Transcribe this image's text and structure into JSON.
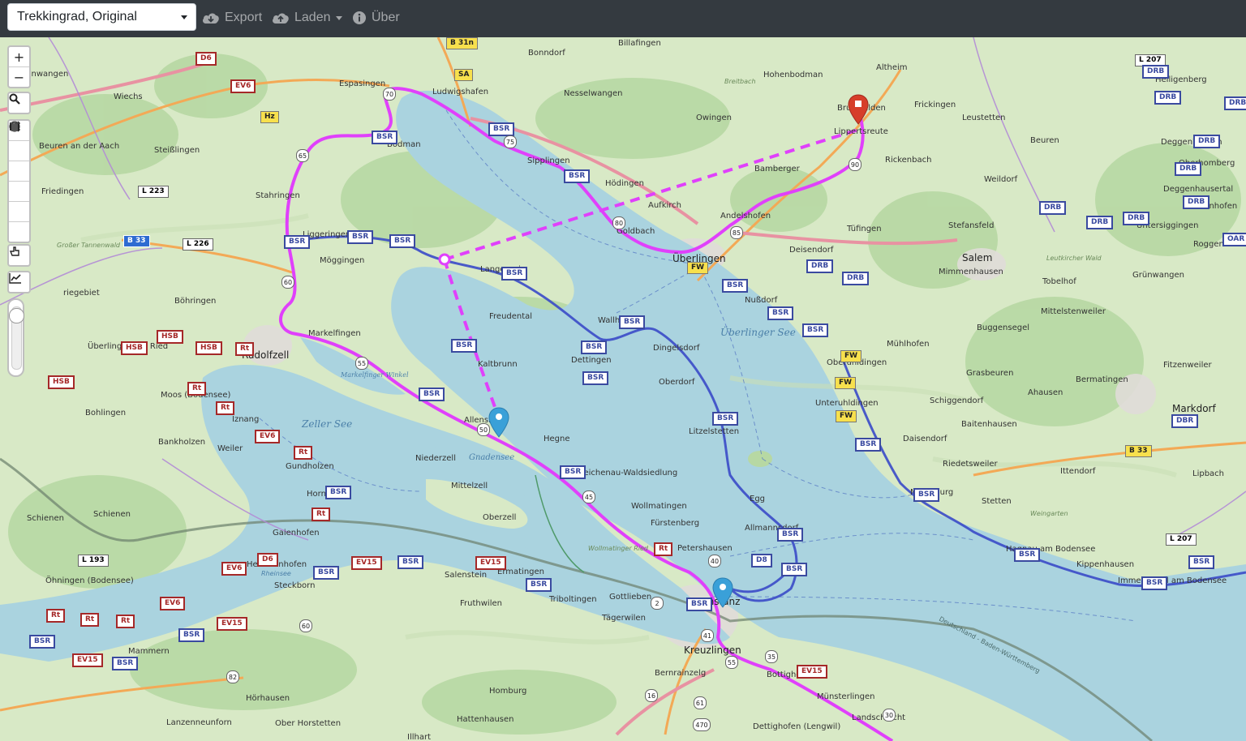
{
  "toolbar": {
    "profile_selected": "Trekkingrad, Original",
    "export_label": "Export",
    "load_label": "Laden",
    "about_label": "Über"
  },
  "map_controls": {
    "zoom_in": "+",
    "zoom_out": "−",
    "search_icon": "search-icon",
    "draw_icon": "pencil-icon",
    "reroute_icon": "shuffle-icon",
    "nogo_icon": "forbidden-icon",
    "circle_icon": "circle-icon",
    "beeline_icon": "beeline-icon",
    "delete_icon": "trash-icon",
    "undo_icon": "hand-pointer-icon",
    "elevation_icon": "chart-line-icon"
  },
  "colors": {
    "route_magenta": "#e040fb",
    "route_blue": "#3a4ac8",
    "marker_blue": "#3aa0d8",
    "marker_red": "#d63e2a",
    "lake": "#aad3df",
    "land": "#d8e9c6",
    "topbar": "#343a40"
  },
  "places": [
    {
      "name": "Billafingen"
    },
    {
      "name": "Bonndorf"
    },
    {
      "name": "Espasingen"
    },
    {
      "name": "Ludwigshafen"
    },
    {
      "name": "Nesselwangen"
    },
    {
      "name": "Owingen"
    },
    {
      "name": "Hohenbodman"
    },
    {
      "name": "Altheim"
    },
    {
      "name": "Heiligenberg"
    },
    {
      "name": "Frickingen"
    },
    {
      "name": "Leustetten"
    },
    {
      "name": "Beuren"
    },
    {
      "name": "Bruckfelden"
    },
    {
      "name": "Lippertsreute"
    },
    {
      "name": "Rickenbach"
    },
    {
      "name": "Bamberger"
    },
    {
      "name": "Bodman"
    },
    {
      "name": "Sipplingen"
    },
    {
      "name": "Hödingen"
    },
    {
      "name": "Aufkirch"
    },
    {
      "name": "Andelshofen"
    },
    {
      "name": "Tüfingen"
    },
    {
      "name": "Weildorf"
    },
    {
      "name": "Salem"
    },
    {
      "name": "Mimmenhausen"
    },
    {
      "name": "Stefansfeld"
    },
    {
      "name": "Tobelhof"
    },
    {
      "name": "Grünwangen"
    },
    {
      "name": "Überlingen"
    },
    {
      "name": "Deisendorf"
    },
    {
      "name": "Nußdorf"
    },
    {
      "name": "Goldbach"
    },
    {
      "name": "Liggeringen"
    },
    {
      "name": "Möggingen"
    },
    {
      "name": "Langenrain"
    },
    {
      "name": "Freudental"
    },
    {
      "name": "Wallhausen"
    },
    {
      "name": "Dettingen"
    },
    {
      "name": "Dingelsdorf"
    },
    {
      "name": "Kaltbrunn"
    },
    {
      "name": "Oberdorf"
    },
    {
      "name": "Litzelstetten"
    },
    {
      "name": "Mühlhofen"
    },
    {
      "name": "Unteruhldingen"
    },
    {
      "name": "Oberuhldingen"
    },
    {
      "name": "Grasbeuren"
    },
    {
      "name": "Ahausen"
    },
    {
      "name": "Bermatingen"
    },
    {
      "name": "Markdorf"
    },
    {
      "name": "Fitzenweiler"
    },
    {
      "name": "Schiggendorf"
    },
    {
      "name": "Baitenhausen"
    },
    {
      "name": "Daisendorf"
    },
    {
      "name": "Riedetsweiler"
    },
    {
      "name": "Ittendorf"
    },
    {
      "name": "Lipbach"
    },
    {
      "name": "Meersburg"
    },
    {
      "name": "Stetten"
    },
    {
      "name": "Radolfzell"
    },
    {
      "name": "Markelfingen"
    },
    {
      "name": "Allensbach"
    },
    {
      "name": "Hegne"
    },
    {
      "name": "Reichenau-Waldsiedlung"
    },
    {
      "name": "Wollmatingen"
    },
    {
      "name": "Fürstenberg"
    },
    {
      "name": "Egg"
    },
    {
      "name": "Allmannsdorf"
    },
    {
      "name": "Petershausen"
    },
    {
      "name": "Konstanz"
    },
    {
      "name": "Kreuzlingen"
    },
    {
      "name": "Bottighofen"
    },
    {
      "name": "Münsterlingen"
    },
    {
      "name": "Landschlacht"
    },
    {
      "name": "Immenstaad am Bodensee"
    },
    {
      "name": "Kippenhausen"
    },
    {
      "name": "Hagnau am Bodensee"
    },
    {
      "name": "Niederzell"
    },
    {
      "name": "Mittelzell"
    },
    {
      "name": "Oberzell"
    },
    {
      "name": "Moos (Bodensee)"
    },
    {
      "name": "Böhringen"
    },
    {
      "name": "Überlingen am Ried"
    },
    {
      "name": "Bohlingen"
    },
    {
      "name": "Iznang"
    },
    {
      "name": "Bankholzen"
    },
    {
      "name": "Weiler"
    },
    {
      "name": "Gundholzen"
    },
    {
      "name": "Horn"
    },
    {
      "name": "Gaienhofen"
    },
    {
      "name": "Schienen"
    },
    {
      "name": "Hemmenhofen"
    },
    {
      "name": "Steckborn"
    },
    {
      "name": "Öhningen (Bodensee)"
    },
    {
      "name": "Salenstein"
    },
    {
      "name": "Ermatingen"
    },
    {
      "name": "Triboltingen"
    },
    {
      "name": "Gottlieben"
    },
    {
      "name": "Tägerwilen"
    },
    {
      "name": "Fruthwilen"
    },
    {
      "name": "Bernrainzelg"
    },
    {
      "name": "Homburg"
    },
    {
      "name": "Hörhausen"
    },
    {
      "name": "Lanzenneunforn"
    },
    {
      "name": "Ober Horstetten"
    },
    {
      "name": "Hattenhausen"
    },
    {
      "name": "Mammern"
    },
    {
      "name": "Wiechs"
    },
    {
      "name": "Steißlingen"
    },
    {
      "name": "Friedingen"
    },
    {
      "name": "Beuren an der Aach"
    },
    {
      "name": "Stahringen"
    },
    {
      "name": "Dettighofen (Lengwil)"
    },
    {
      "name": "Illhart"
    },
    {
      "name": "Deggenhausertal"
    },
    {
      "name": "Untersiggingen"
    },
    {
      "name": "Roggenbeuren"
    },
    {
      "name": "Mittelstenweiler"
    },
    {
      "name": "Buggensegel"
    },
    {
      "name": "Deggenhausen"
    },
    {
      "name": "Oberhomberg"
    },
    {
      "name": "Wittenhofen"
    },
    {
      "name": "Mainwangen"
    },
    {
      "name": "Schienen"
    }
  ],
  "water_labels": [
    "Überlinger See",
    "Zeller See",
    "Gnadensee",
    "Markelfinger Winkel"
  ],
  "misc_labels": [
    "Breitbach",
    "Großer Tannenwald",
    "Leutkircher Wald",
    "Weingarten",
    "Wollmatinger Ried",
    "riegebiet",
    "Deutschland - Baden-Württemberg",
    "Rheinsee"
  ],
  "road_shields": {
    "bsr": "BSR",
    "ev15": "EV15",
    "ev6": "EV6",
    "d6": "D6",
    "d8": "D8",
    "drb": "DRB",
    "fw": "FW",
    "hsb": "HSB",
    "hz": "Hz",
    "rt": "Rt",
    "b31n": "B 31n",
    "b33": "B 33",
    "b33b": "B 33",
    "l223": "L 223",
    "l226": "L 226",
    "l193": "L 193",
    "l207": "L 207",
    "l207b": "L 207",
    "oar": "OAR",
    "sa": "SA",
    "dbr": "DBR"
  },
  "route_numbers": [
    "70",
    "75",
    "80",
    "85",
    "90",
    "65",
    "60",
    "55",
    "50",
    "45",
    "40",
    "35",
    "30",
    "2",
    "41",
    "55",
    "60",
    "82",
    "61",
    "470",
    "16"
  ]
}
